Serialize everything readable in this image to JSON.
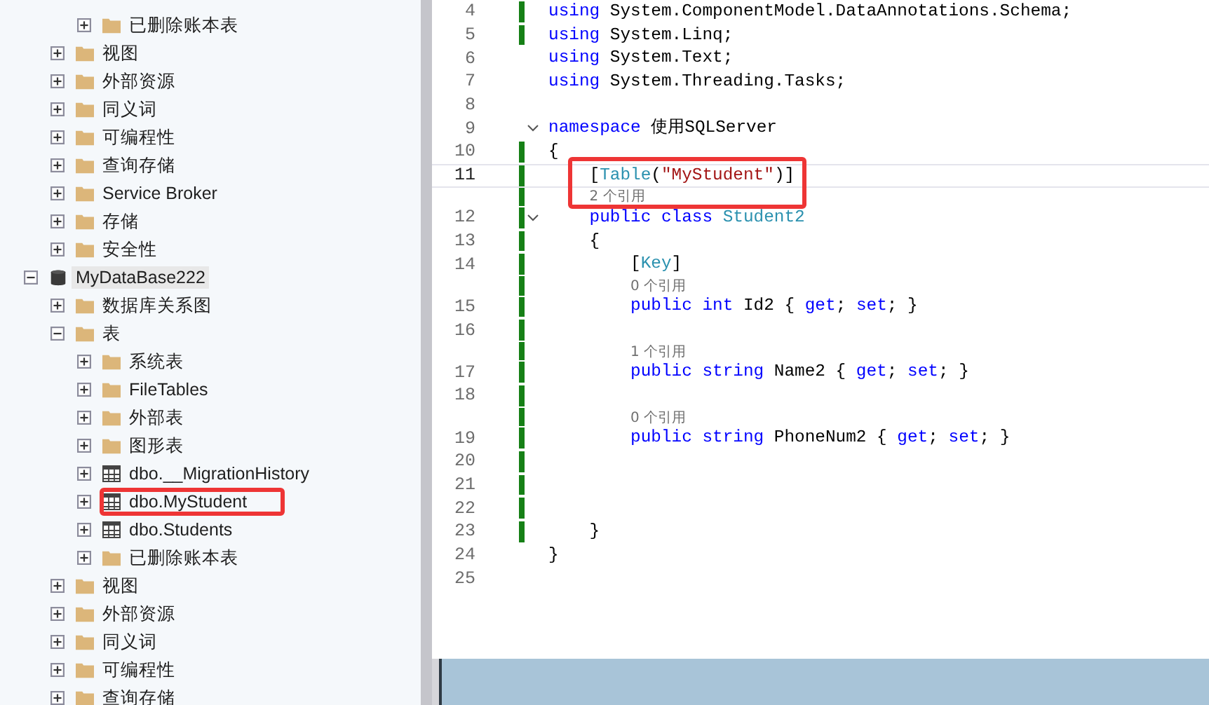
{
  "object_explorer": {
    "tree": [
      {
        "children": [
          {
            "children": [
              {
                "kind": "folder",
                "label": "已删除账本表",
                "expanded": false,
                "selected": false
              }
            ]
          },
          {
            "kind": "folder",
            "label": "视图",
            "expanded": false,
            "selected": false
          },
          {
            "kind": "folder",
            "label": "外部资源",
            "expanded": false,
            "selected": false
          },
          {
            "kind": "folder",
            "label": "同义词",
            "expanded": false,
            "selected": false
          },
          {
            "kind": "folder",
            "label": "可编程性",
            "expanded": false,
            "selected": false
          },
          {
            "kind": "folder",
            "label": "查询存储",
            "expanded": false,
            "selected": false
          },
          {
            "kind": "folder",
            "label": "Service Broker",
            "expanded": false,
            "selected": false
          },
          {
            "kind": "folder",
            "label": "存储",
            "expanded": false,
            "selected": false
          },
          {
            "kind": "folder",
            "label": "安全性",
            "expanded": false,
            "selected": false
          }
        ]
      },
      {
        "kind": "database",
        "label": "MyDataBase222",
        "expanded": true,
        "selected": true,
        "children": [
          {
            "kind": "folder",
            "label": "数据库关系图",
            "expanded": false,
            "selected": false
          },
          {
            "kind": "folder",
            "label": "表",
            "expanded": true,
            "selected": false,
            "children": [
              {
                "kind": "folder",
                "label": "系统表",
                "expanded": false,
                "selected": false
              },
              {
                "kind": "folder",
                "label": "FileTables",
                "expanded": false,
                "selected": false
              },
              {
                "kind": "folder",
                "label": "外部表",
                "expanded": false,
                "selected": false
              },
              {
                "kind": "folder",
                "label": "图形表",
                "expanded": false,
                "selected": false
              },
              {
                "kind": "table",
                "label": "dbo.__MigrationHistory",
                "expanded": false,
                "selected": false
              },
              {
                "kind": "table",
                "label": "dbo.MyStudent",
                "expanded": false,
                "selected": false,
                "annotated": true
              },
              {
                "kind": "table",
                "label": "dbo.Students",
                "expanded": false,
                "selected": false
              },
              {
                "kind": "folder",
                "label": "已删除账本表",
                "expanded": false,
                "selected": false
              }
            ]
          },
          {
            "kind": "folder",
            "label": "视图",
            "expanded": false,
            "selected": false
          },
          {
            "kind": "folder",
            "label": "外部资源",
            "expanded": false,
            "selected": false
          },
          {
            "kind": "folder",
            "label": "同义词",
            "expanded": false,
            "selected": false
          },
          {
            "kind": "folder",
            "label": "可编程性",
            "expanded": false,
            "selected": false
          },
          {
            "kind": "folder",
            "label": "查询存储",
            "expanded": false,
            "selected": false
          }
        ]
      }
    ]
  },
  "editor": {
    "lines": [
      {
        "number": "4",
        "changed": true,
        "fold": false,
        "current": false,
        "tokens": [
          {
            "kind": "kw",
            "text": "using"
          },
          {
            "kind": "plain",
            "text": " System.ComponentModel.DataAnnotations.Schema;"
          }
        ]
      },
      {
        "number": "5",
        "changed": true,
        "fold": false,
        "current": false,
        "tokens": [
          {
            "kind": "kw",
            "text": "using"
          },
          {
            "kind": "plain",
            "text": " System.Linq;"
          }
        ]
      },
      {
        "number": "6",
        "changed": false,
        "fold": false,
        "current": false,
        "tokens": [
          {
            "kind": "kw",
            "text": "using"
          },
          {
            "kind": "plain",
            "text": " System.Text;"
          }
        ]
      },
      {
        "number": "7",
        "changed": false,
        "fold": false,
        "current": false,
        "tokens": [
          {
            "kind": "kw",
            "text": "using"
          },
          {
            "kind": "plain",
            "text": " System.Threading.Tasks;"
          }
        ]
      },
      {
        "number": "8",
        "changed": false,
        "fold": false,
        "current": false
      },
      {
        "number": "9",
        "changed": false,
        "fold": true,
        "current": false,
        "tokens": [
          {
            "kind": "kw",
            "text": "namespace"
          },
          {
            "kind": "plain",
            "text": " 使用SQLServer"
          }
        ]
      },
      {
        "number": "10",
        "changed": true,
        "fold": false,
        "current": false,
        "tokens": [
          {
            "kind": "plain",
            "text": "{"
          }
        ]
      },
      {
        "number": "11",
        "changed": true,
        "fold": false,
        "current": true,
        "annotated": true,
        "tokens": [
          {
            "kind": "plain",
            "text": "    ["
          },
          {
            "kind": "type",
            "text": "Table"
          },
          {
            "kind": "plain",
            "text": "("
          },
          {
            "kind": "str",
            "text": "\"MyStudent\""
          },
          {
            "kind": "plain",
            "text": ")]"
          }
        ]
      },
      {
        "number": "12",
        "changed": true,
        "fold": true,
        "current": false,
        "lens": "2 个引用",
        "tokens": [
          {
            "kind": "kw",
            "text": "    public class "
          },
          {
            "kind": "type",
            "text": "Student2"
          }
        ]
      },
      {
        "number": "13",
        "changed": true,
        "fold": false,
        "current": false,
        "tokens": [
          {
            "kind": "plain",
            "text": "    {"
          }
        ]
      },
      {
        "number": "14",
        "changed": true,
        "fold": false,
        "current": false,
        "tokens": [
          {
            "kind": "plain",
            "text": "        ["
          },
          {
            "kind": "type",
            "text": "Key"
          },
          {
            "kind": "plain",
            "text": "]"
          }
        ]
      },
      {
        "number": "15",
        "changed": true,
        "fold": false,
        "current": false,
        "lens": "0 个引用",
        "tokens": [
          {
            "kind": "kw",
            "text": "        public int"
          },
          {
            "kind": "plain",
            "text": " Id2 { "
          },
          {
            "kind": "kw",
            "text": "get"
          },
          {
            "kind": "plain",
            "text": "; "
          },
          {
            "kind": "kw",
            "text": "set"
          },
          {
            "kind": "plain",
            "text": "; }"
          }
        ]
      },
      {
        "number": "16",
        "changed": true,
        "fold": false,
        "current": false
      },
      {
        "number": "17",
        "changed": true,
        "fold": false,
        "current": false,
        "lens": "1 个引用",
        "tokens": [
          {
            "kind": "kw",
            "text": "        public string"
          },
          {
            "kind": "plain",
            "text": " Name2 { "
          },
          {
            "kind": "kw",
            "text": "get"
          },
          {
            "kind": "plain",
            "text": "; "
          },
          {
            "kind": "kw",
            "text": "set"
          },
          {
            "kind": "plain",
            "text": "; }"
          }
        ]
      },
      {
        "number": "18",
        "changed": true,
        "fold": false,
        "current": false
      },
      {
        "number": "19",
        "changed": true,
        "fold": false,
        "current": false,
        "lens": "0 个引用",
        "tokens": [
          {
            "kind": "kw",
            "text": "        public string"
          },
          {
            "kind": "plain",
            "text": " PhoneNum2 { "
          },
          {
            "kind": "kw",
            "text": "get"
          },
          {
            "kind": "plain",
            "text": "; "
          },
          {
            "kind": "kw",
            "text": "set"
          },
          {
            "kind": "plain",
            "text": "; }"
          }
        ]
      },
      {
        "number": "20",
        "changed": true,
        "fold": false,
        "current": false
      },
      {
        "number": "21",
        "changed": true,
        "fold": false,
        "current": false
      },
      {
        "number": "22",
        "changed": true,
        "fold": false,
        "current": false
      },
      {
        "number": "23",
        "changed": true,
        "fold": false,
        "current": false,
        "tokens": [
          {
            "kind": "plain",
            "text": "    }"
          }
        ]
      },
      {
        "number": "24",
        "changed": false,
        "fold": false,
        "current": false,
        "tokens": [
          {
            "kind": "plain",
            "text": "}"
          }
        ]
      },
      {
        "number": "25",
        "changed": false,
        "fold": false,
        "current": false
      }
    ]
  }
}
